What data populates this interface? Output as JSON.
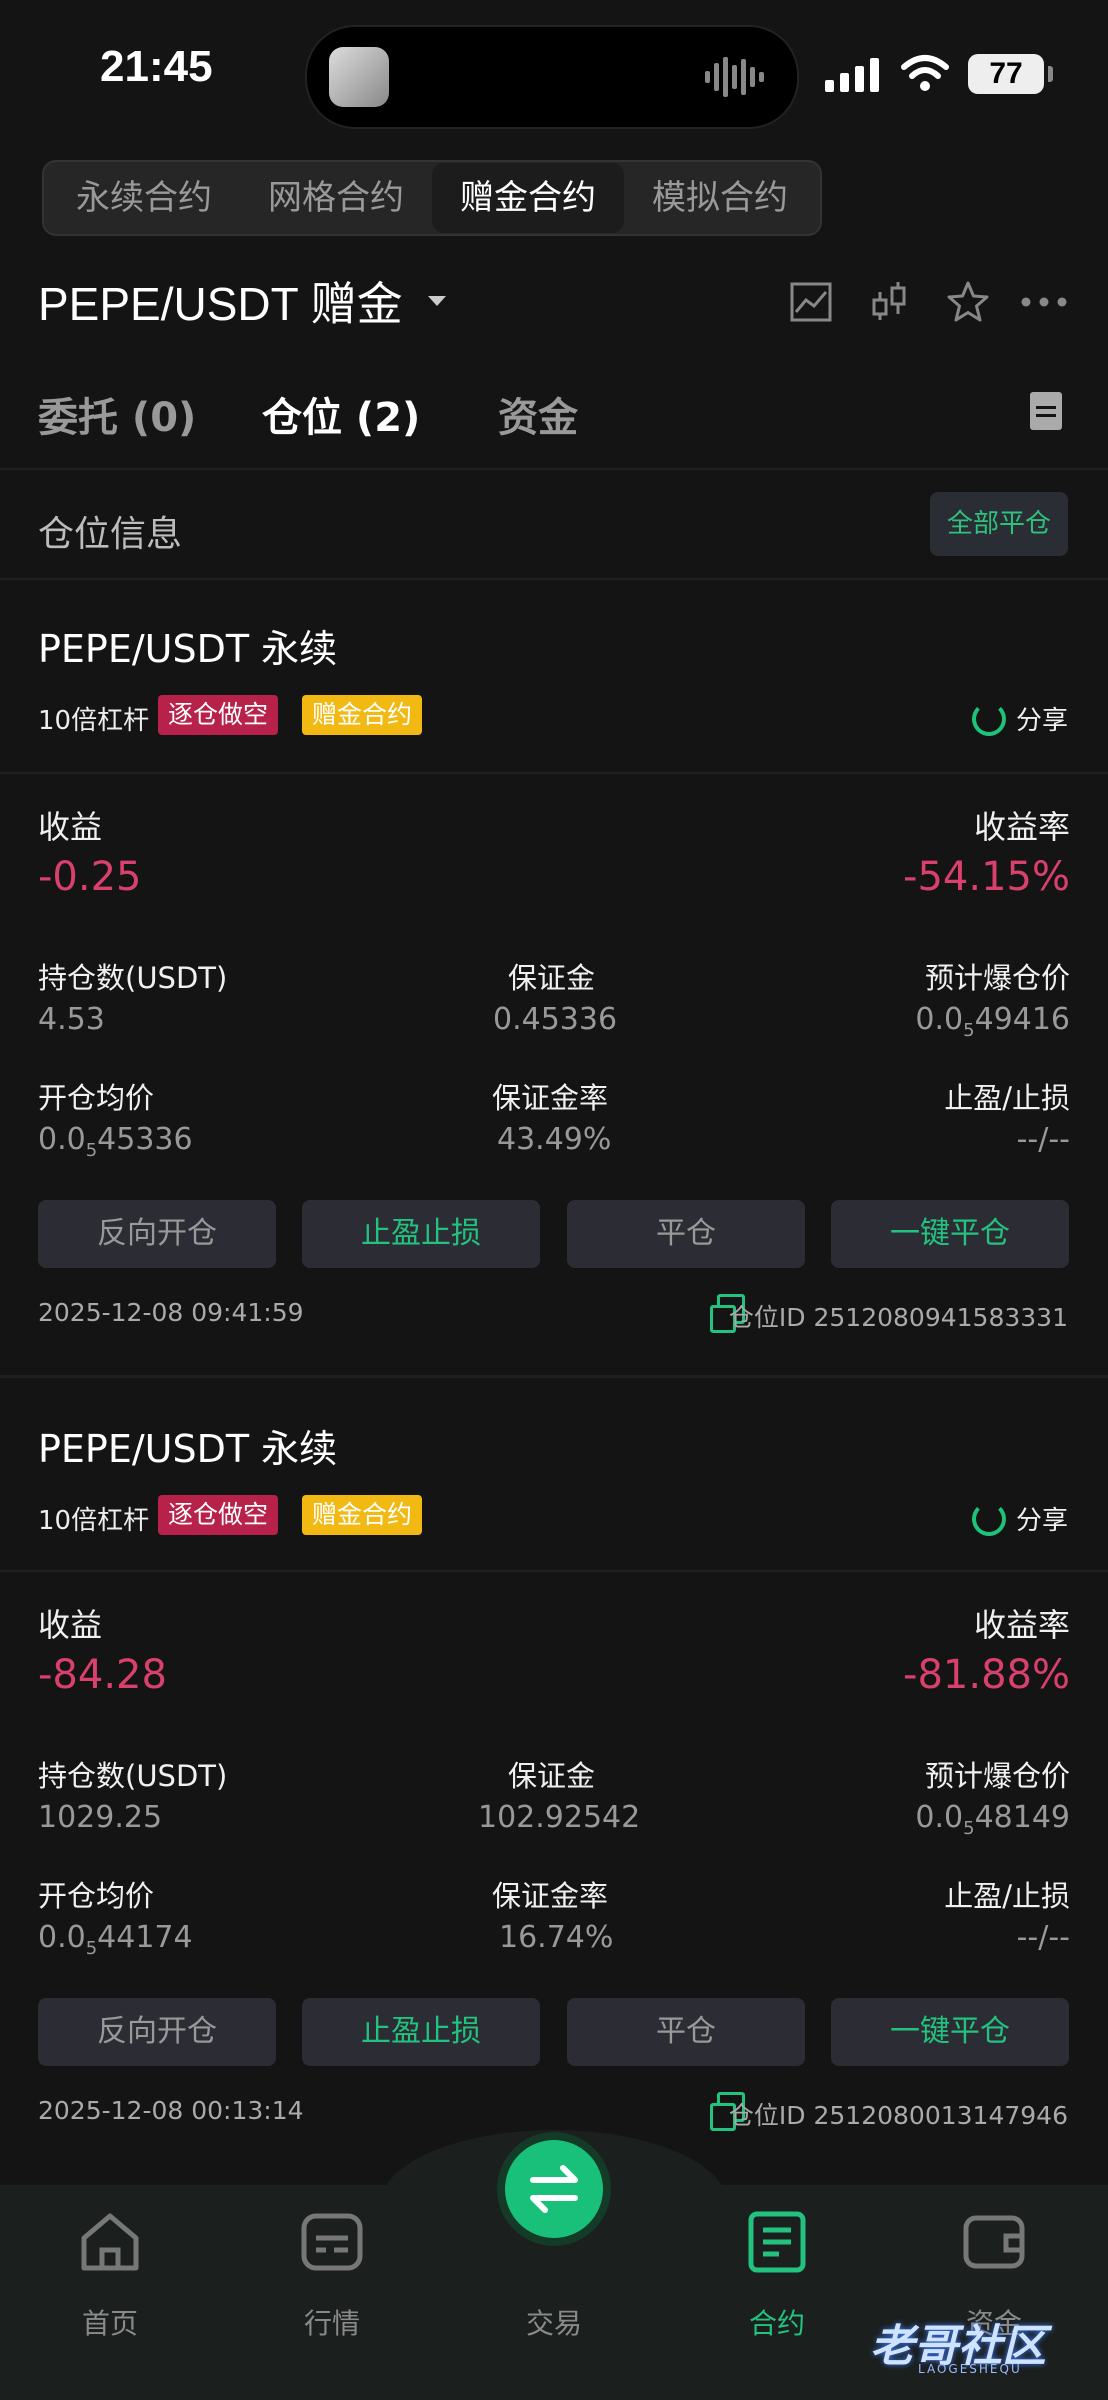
{
  "status": {
    "time": "21:45",
    "battery": "77"
  },
  "top_tabs": [
    "永续合约",
    "网格合约",
    "赠金合约",
    "模拟合约"
  ],
  "header": {
    "pair": "PEPE/USDT 赠金"
  },
  "sub_tabs": {
    "orders": "委托 (0)",
    "positions": "仓位 (2)",
    "funds": "资金"
  },
  "section": {
    "title": "仓位信息",
    "close_all": "全部平仓"
  },
  "labels": {
    "pnl": "收益",
    "roe": "收益率",
    "size": "持仓数(USDT)",
    "margin": "保证金",
    "liq": "预计爆仓价",
    "entry": "开仓均价",
    "margin_ratio": "保证金率",
    "tpsl": "止盈/止损",
    "share": "分享",
    "position_id": "仓位ID"
  },
  "buttons": {
    "reverse": "反向开仓",
    "tpsl": "止盈止损",
    "close": "平仓",
    "flash_close": "一键平仓"
  },
  "positions": [
    {
      "symbol": "PEPE/USDT 永续",
      "leverage": "10倍杠杆",
      "mode": "逐仓做空",
      "type": "赠金合约",
      "pnl": "-0.25",
      "roe": "-54.15%",
      "size": "4.53",
      "margin": "0.45336",
      "liq_prefix": "0.0",
      "liq_sub": "5",
      "liq_rest": "49416",
      "entry_prefix": "0.0",
      "entry_sub": "5",
      "entry_rest": "45336",
      "margin_ratio": "43.49%",
      "tpsl": "--/--",
      "time": "2025-12-08 09:41:59",
      "id": "2512080941583331"
    },
    {
      "symbol": "PEPE/USDT 永续",
      "leverage": "10倍杠杆",
      "mode": "逐仓做空",
      "type": "赠金合约",
      "pnl": "-84.28",
      "roe": "-81.88%",
      "size": "1029.25",
      "margin": "102.92542",
      "liq_prefix": "0.0",
      "liq_sub": "5",
      "liq_rest": "48149",
      "entry_prefix": "0.0",
      "entry_sub": "5",
      "entry_rest": "44174",
      "margin_ratio": "16.74%",
      "tpsl": "--/--",
      "time": "2025-12-08 00:13:14",
      "id": "2512080013147946"
    }
  ],
  "nav": [
    "首页",
    "行情",
    "交易",
    "合约",
    "资金"
  ],
  "watermark": {
    "main": "老哥社区",
    "sub": "LAOGESHEQU"
  },
  "colors": {
    "accent": "#23c27f",
    "negative": "#d9406b",
    "tag_short": "#b8214a",
    "tag_gift": "#f3b913"
  }
}
